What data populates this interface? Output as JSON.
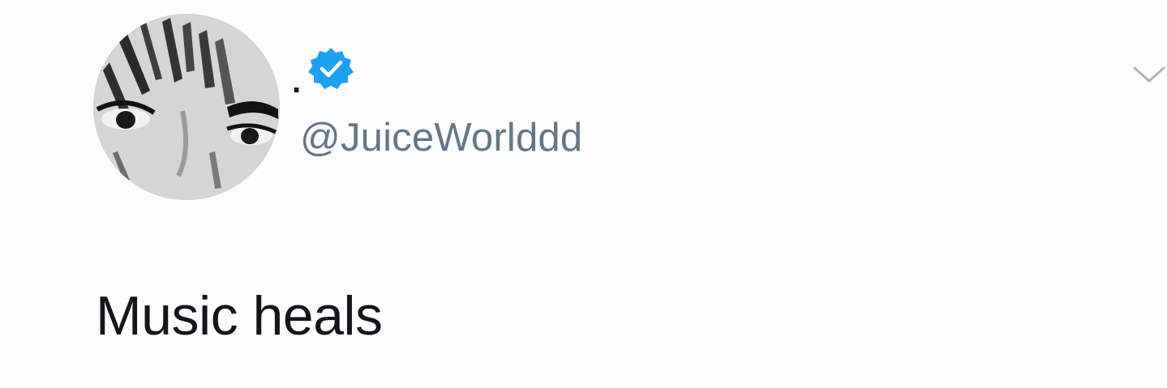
{
  "tweet": {
    "display_name": ".",
    "handle": "@JuiceWorlddd",
    "text": "Music heals",
    "verified": true
  },
  "icons": {
    "verified": "verified-badge-icon",
    "menu": "chevron-down-icon",
    "avatar": "profile-avatar"
  },
  "colors": {
    "verified_blue": "#1da1f2",
    "handle_gray": "#657786",
    "text_dark": "#14171a",
    "background": "#ffffff"
  }
}
